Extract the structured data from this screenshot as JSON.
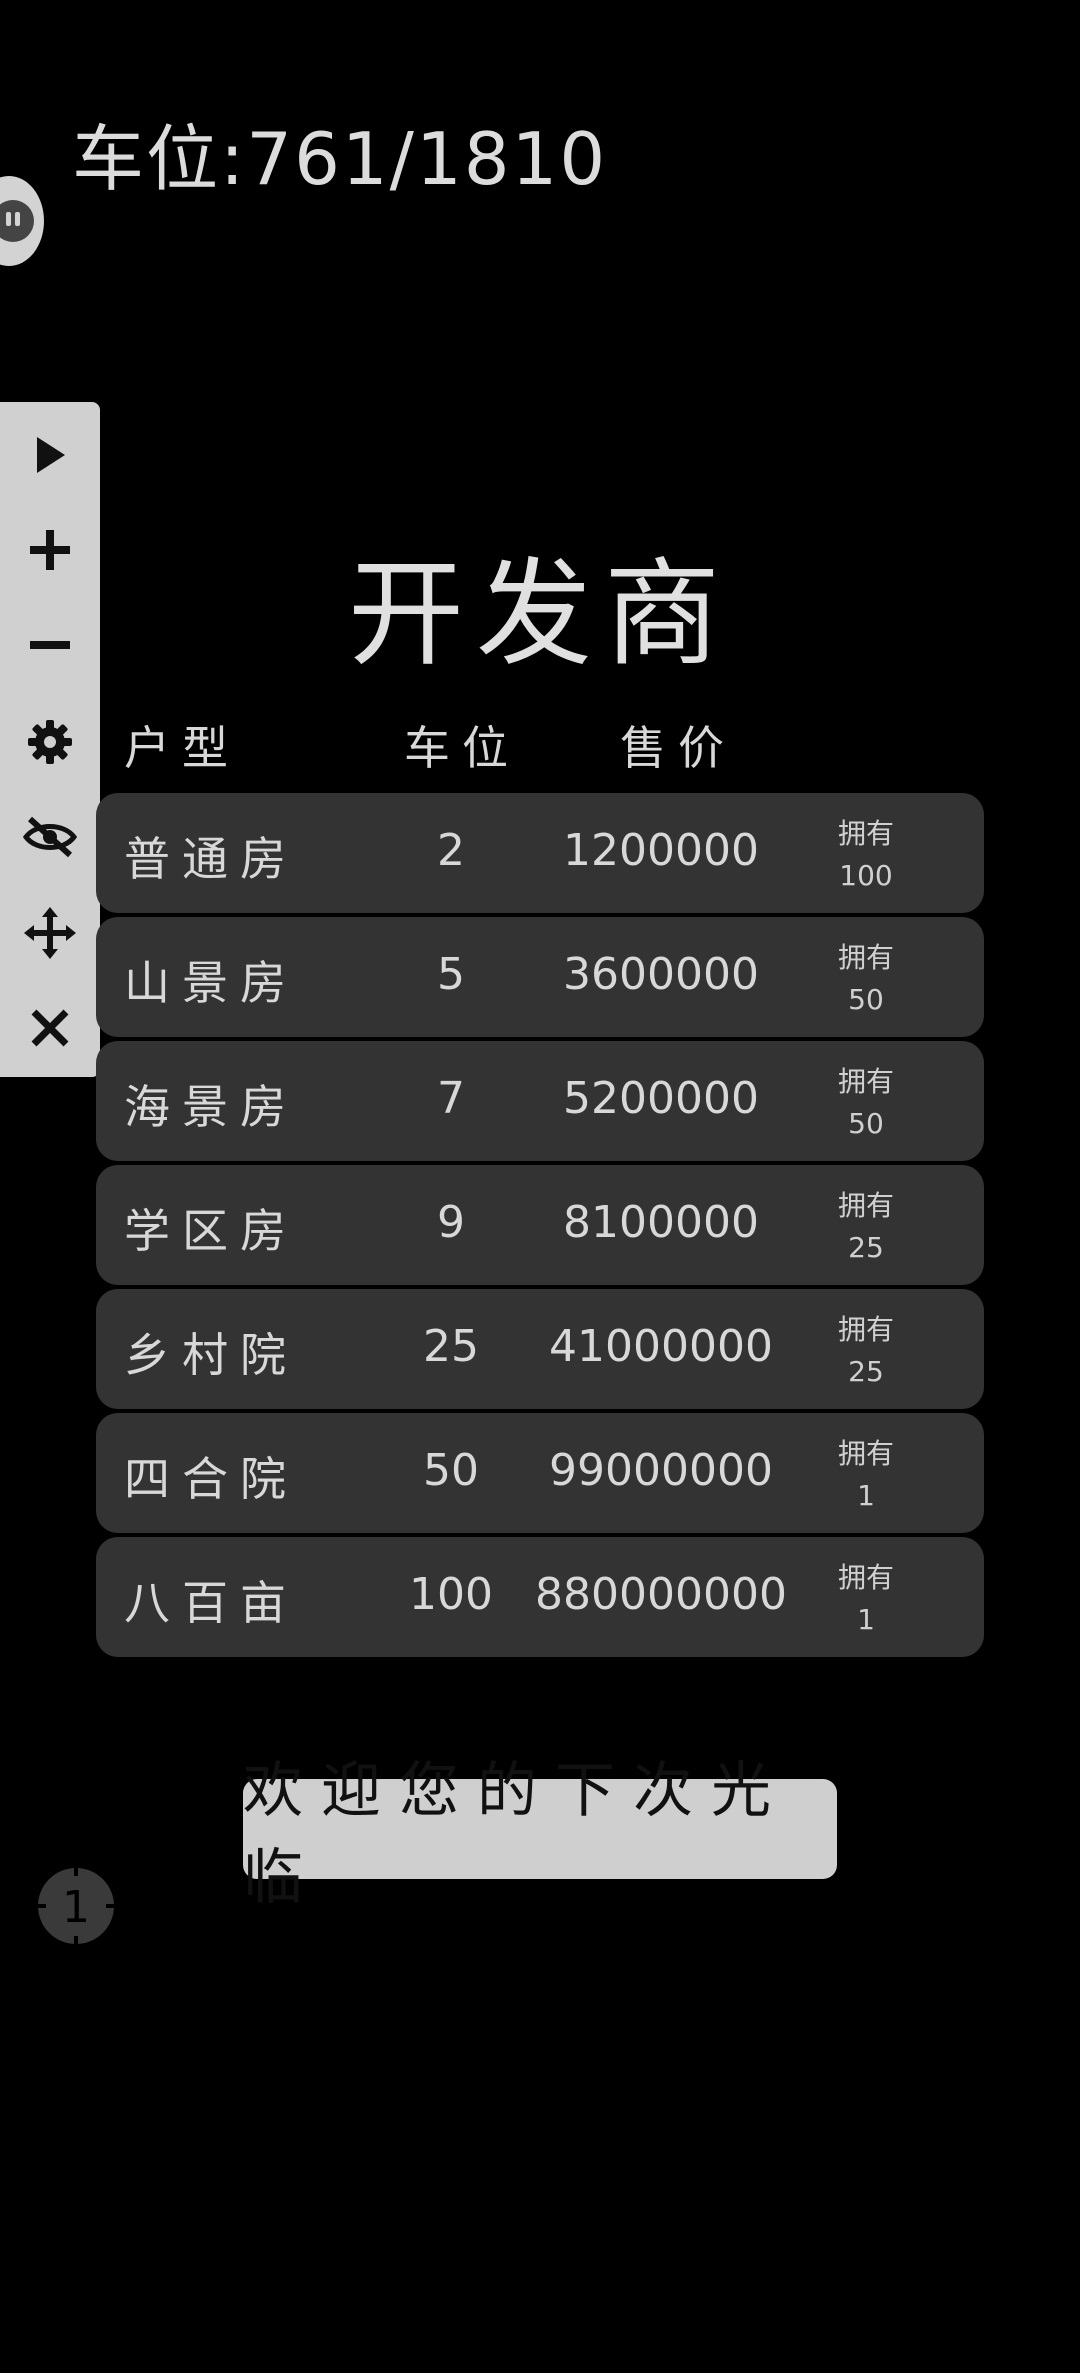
{
  "header": {
    "parking_label": "车位:761/1810"
  },
  "toolbar": {
    "icons": [
      "play-icon",
      "plus-icon",
      "minus-icon",
      "gear-icon",
      "eye-off-icon",
      "move-icon",
      "close-icon"
    ]
  },
  "main": {
    "title": "开发商",
    "columns": {
      "type": "户型",
      "spots": "车位",
      "price": "售价"
    },
    "own_label": "拥有",
    "rows": [
      {
        "name": "普通房",
        "spots": "2",
        "price": "1200000",
        "owned": "100"
      },
      {
        "name": "山景房",
        "spots": "5",
        "price": "3600000",
        "owned": "50"
      },
      {
        "name": "海景房",
        "spots": "7",
        "price": "5200000",
        "owned": "50"
      },
      {
        "name": "学区房",
        "spots": "9",
        "price": "8100000",
        "owned": "25"
      },
      {
        "name": "乡村院",
        "spots": "25",
        "price": "41000000",
        "owned": "25"
      },
      {
        "name": "四合院",
        "spots": "50",
        "price": "99000000",
        "owned": "1"
      },
      {
        "name": "八百亩",
        "spots": "100",
        "price": "880000000",
        "owned": "1"
      }
    ],
    "farewell_button": "欢迎您的下次光临"
  },
  "crosshair": {
    "label": "1"
  }
}
